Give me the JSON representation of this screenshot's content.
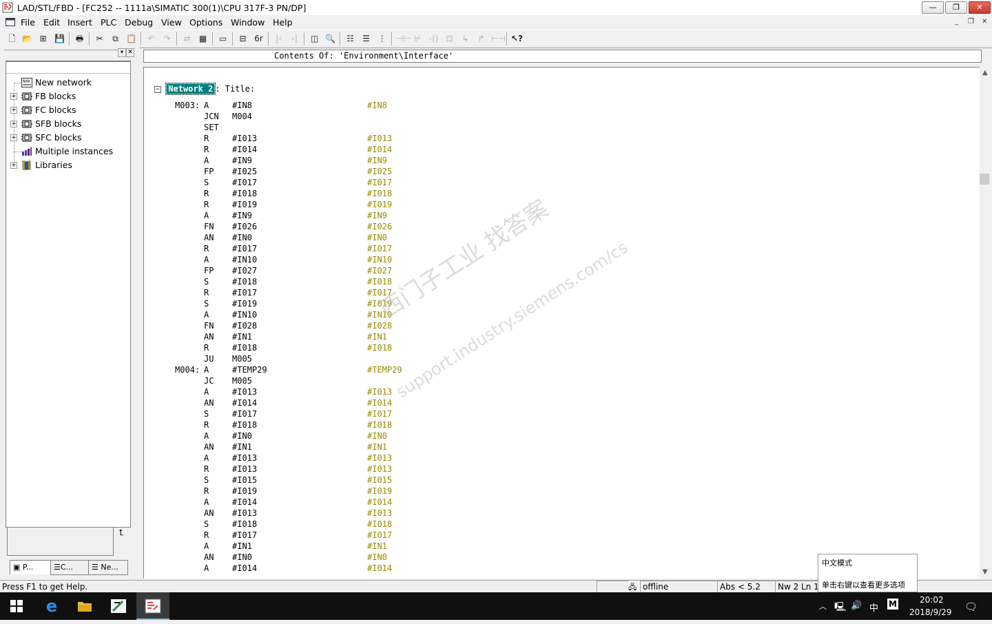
{
  "window": {
    "title": "LAD/STL/FBD  - [FC252 -- 1111a\\SIMATIC 300(1)\\CPU 317F-3 PN/DP]",
    "min_label": "▭",
    "restore_label": "❐",
    "close_label": "✕"
  },
  "menu": {
    "items": [
      "File",
      "Edit",
      "Insert",
      "PLC",
      "Debug",
      "View",
      "Options",
      "Window",
      "Help"
    ],
    "mdi_min": "_",
    "mdi_restore": "❐",
    "mdi_close": "✕"
  },
  "toolbar": {
    "icons": [
      "new-icon",
      "open-icon",
      "accessible-nodes-icon",
      "save-icon",
      "print-icon",
      "cut-icon",
      "copy-icon",
      "paste-icon",
      "undo-icon",
      "redo-icon",
      "load-icon",
      "compile-icon",
      "monitor-icon",
      "overview-icon",
      "details-icon",
      "zoom-icon",
      "network-icon",
      "insert-row-icon",
      "branch-icon",
      "contact-no-icon",
      "contact-nc-icon",
      "coil-icon",
      "box-icon",
      "open-branch-icon",
      "close-branch-icon",
      "connector-icon",
      "help-icon"
    ]
  },
  "tree": {
    "items": [
      {
        "label": "New network",
        "icon": "network-icon",
        "expandable": false
      },
      {
        "label": "FB blocks",
        "icon": "block-icon",
        "expandable": true
      },
      {
        "label": "FC blocks",
        "icon": "block-icon",
        "expandable": true
      },
      {
        "label": "SFB blocks",
        "icon": "block-icon",
        "expandable": true
      },
      {
        "label": "SFC blocks",
        "icon": "block-icon",
        "expandable": true
      },
      {
        "label": "Multiple instances",
        "icon": "instances-icon",
        "expandable": false
      },
      {
        "label": "Libraries",
        "icon": "library-icon",
        "expandable": true
      }
    ],
    "bottom_button": "⮤",
    "tabs": [
      "P...",
      "C...",
      "Ne..."
    ]
  },
  "editor": {
    "path": "Contents Of: 'Environment\\Interface'",
    "network_label": "Network 2",
    "network_title": ": Title:",
    "lines": [
      {
        "label": "M003:",
        "op": "A",
        "arg": "#IN8",
        "cmt": "#IN8"
      },
      {
        "label": "",
        "op": "JCN",
        "arg": "M004",
        "cmt": ""
      },
      {
        "label": "",
        "op": "SET",
        "arg": "",
        "cmt": ""
      },
      {
        "label": "",
        "op": "R",
        "arg": "#I013",
        "cmt": "#I013"
      },
      {
        "label": "",
        "op": "R",
        "arg": "#I014",
        "cmt": "#I014"
      },
      {
        "label": "",
        "op": "A",
        "arg": "#IN9",
        "cmt": "#IN9"
      },
      {
        "label": "",
        "op": "FP",
        "arg": "#I025",
        "cmt": "#I025"
      },
      {
        "label": "",
        "op": "S",
        "arg": "#I017",
        "cmt": "#I017"
      },
      {
        "label": "",
        "op": "R",
        "arg": "#I018",
        "cmt": "#I018"
      },
      {
        "label": "",
        "op": "R",
        "arg": "#I019",
        "cmt": "#I019"
      },
      {
        "label": "",
        "op": "A",
        "arg": "#IN9",
        "cmt": "#IN9"
      },
      {
        "label": "",
        "op": "FN",
        "arg": "#I026",
        "cmt": "#I026"
      },
      {
        "label": "",
        "op": "AN",
        "arg": "#IN0",
        "cmt": "#IN0"
      },
      {
        "label": "",
        "op": "R",
        "arg": "#I017",
        "cmt": "#I017"
      },
      {
        "label": "",
        "op": "A",
        "arg": "#IN10",
        "cmt": "#IN10"
      },
      {
        "label": "",
        "op": "FP",
        "arg": "#I027",
        "cmt": "#I027"
      },
      {
        "label": "",
        "op": "S",
        "arg": "#I018",
        "cmt": "#I018"
      },
      {
        "label": "",
        "op": "R",
        "arg": "#I017",
        "cmt": "#I017"
      },
      {
        "label": "",
        "op": "S",
        "arg": "#I019",
        "cmt": "#I019"
      },
      {
        "label": "",
        "op": "A",
        "arg": "#IN10",
        "cmt": "#IN10"
      },
      {
        "label": "",
        "op": "FN",
        "arg": "#I028",
        "cmt": "#I028"
      },
      {
        "label": "",
        "op": "AN",
        "arg": "#IN1",
        "cmt": "#IN1"
      },
      {
        "label": "",
        "op": "R",
        "arg": "#I018",
        "cmt": "#I018"
      },
      {
        "label": "",
        "op": "JU",
        "arg": "M005",
        "cmt": ""
      },
      {
        "label": "M004:",
        "op": "A",
        "arg": "#TEMP29",
        "cmt": "#TEMP29"
      },
      {
        "label": "",
        "op": "JC",
        "arg": "M005",
        "cmt": ""
      },
      {
        "label": "",
        "op": "A",
        "arg": "#I013",
        "cmt": "#I013"
      },
      {
        "label": "",
        "op": "AN",
        "arg": "#I014",
        "cmt": "#I014"
      },
      {
        "label": "",
        "op": "S",
        "arg": "#I017",
        "cmt": "#I017"
      },
      {
        "label": "",
        "op": "R",
        "arg": "#I018",
        "cmt": "#I018"
      },
      {
        "label": "",
        "op": "A",
        "arg": "#IN0",
        "cmt": "#IN0"
      },
      {
        "label": "",
        "op": "AN",
        "arg": "#IN1",
        "cmt": "#IN1"
      },
      {
        "label": "",
        "op": "A",
        "arg": "#I013",
        "cmt": "#I013"
      },
      {
        "label": "",
        "op": "R",
        "arg": "#I013",
        "cmt": "#I013"
      },
      {
        "label": "",
        "op": "S",
        "arg": "#I015",
        "cmt": "#I015"
      },
      {
        "label": "",
        "op": "R",
        "arg": "#I019",
        "cmt": "#I019"
      },
      {
        "label": "",
        "op": "A",
        "arg": "#I014",
        "cmt": "#I014"
      },
      {
        "label": "",
        "op": "AN",
        "arg": "#I013",
        "cmt": "#I013"
      },
      {
        "label": "",
        "op": "S",
        "arg": "#I018",
        "cmt": "#I018"
      },
      {
        "label": "",
        "op": "R",
        "arg": "#I017",
        "cmt": "#I017"
      },
      {
        "label": "",
        "op": "A",
        "arg": "#IN1",
        "cmt": "#IN1"
      },
      {
        "label": "",
        "op": "AN",
        "arg": "#IN0",
        "cmt": "#IN0"
      },
      {
        "label": "",
        "op": "A",
        "arg": "#I014",
        "cmt": "#I014"
      }
    ],
    "watermark_line1": "西门子工业  找答案",
    "watermark_line2": "support.industry.siemens.com/cs"
  },
  "status": {
    "help": "Press F1 to get Help.",
    "mode": "offline",
    "abs": "Abs < 5.2",
    "nw": "Nw 2  Ln 1"
  },
  "ime_tip": {
    "line1": "中文模式",
    "line2": "单击右键以查看更多选项"
  },
  "taskbar": {
    "tray_lang": "中",
    "tray_ime": "M",
    "time": "20:02",
    "date": "2018/9/29"
  }
}
